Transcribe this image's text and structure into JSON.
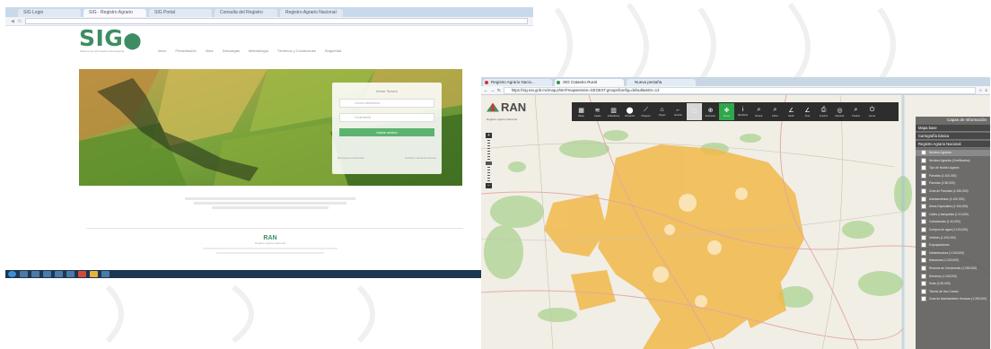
{
  "left_screenshot": {
    "tabs": [
      "SIG Login",
      "SIG · Registro Agrario",
      "SIG Portal",
      "Consulta del Registro",
      "Registro Agrario Nacional"
    ],
    "logo_text": "SIG",
    "logo_subtitle": "Sistema de Información Geoespacial",
    "nav": [
      "Inicio",
      "Presentación",
      "Visor",
      "Descargas",
      "Metodología",
      "Términos y Condiciones",
      "Seguridad"
    ],
    "login": {
      "title": "Iniciar Sesión",
      "user_placeholder": "Correo electrónico",
      "password_placeholder": "Contraseña",
      "button": "Iniciar sesión",
      "link_forgot": "Recuperar contraseña",
      "link_register": "Solicitar cuenta de acceso"
    },
    "footer_brand": "RAN",
    "footer_text": "Registro Agrario Nacional"
  },
  "right_screenshot": {
    "tabs": [
      {
        "label": "Registro Agrario Nacio...",
        "color": "#d9342b"
      },
      {
        "label": "SIG Catastro Rural",
        "color": "#3a8f4c"
      },
      {
        "label": "Nueva pestaña",
        "color": ""
      }
    ],
    "url": "https://sig.ran.gob.mx/map.phtml?mapsession=GEOEXT.groupsfconfig=default&mEn=13",
    "logo": "RAN",
    "logo_sub": "Registro Agrario Nacional",
    "tools": [
      {
        "label": "Mapa",
        "icon": "▦"
      },
      {
        "label": "Capas",
        "icon": "≋"
      },
      {
        "label": "Indicadores",
        "icon": "▥"
      },
      {
        "label": "Ubicación",
        "icon": "⬤"
      },
      {
        "label": "Polígono",
        "icon": "⟋"
      },
      {
        "label": "Origen",
        "icon": "⌂"
      },
      {
        "label": "Anterior",
        "icon": "←"
      },
      {
        "label": "",
        "icon": "□"
      },
      {
        "label": "Extensión",
        "icon": "⊕"
      },
      {
        "label": "Mover",
        "icon": "✥"
      },
      {
        "label": "Identificar",
        "icon": "i"
      },
      {
        "label": "Buscar",
        "icon": "⌕"
      },
      {
        "label": "Filtrar",
        "icon": "⌕"
      },
      {
        "label": "Medir",
        "icon": "∠"
      },
      {
        "label": "Área",
        "icon": "∠"
      },
      {
        "label": "Imprimir",
        "icon": "⎙"
      },
      {
        "label": "Exportar",
        "icon": "◎"
      },
      {
        "label": "Predios",
        "icon": "⌕"
      },
      {
        "label": "Cerrar",
        "icon": "⏻"
      }
    ],
    "panel": {
      "title": "Capas de Información",
      "sections": [
        "Mapa base",
        "Cartografía básica",
        "Registro Agrario Nacional"
      ],
      "layers": [
        "Núcleos Agrarios",
        "Núcleos Agrarios (Certificados)",
        "Tipo de Núcleo Agrario",
        "Parcelas (1:100,000)",
        "Parcelas (1:50,000)",
        "Zona de Parcelas (1:250,000)",
        "Asentamientos (1:100,000)",
        "Áreas Especiales (1:100,000)",
        "Calles y banquetas (1:10,000)",
        "Colindancias (1:10,000)",
        "Cuerpos de agua (1:100,000)",
        "Vértices (1:100,000)",
        "Expropiaciones",
        "Infraestructura (1:100,000)",
        "Manzanas (1:100,000)",
        "Reserva de Crecimiento (1:250,000)",
        "Servicios (1:100,000)",
        "Solar (1:50,000)",
        "Tierras de Uso Común",
        "Zona de Asentamiento Humano (1:250,000)"
      ]
    }
  }
}
